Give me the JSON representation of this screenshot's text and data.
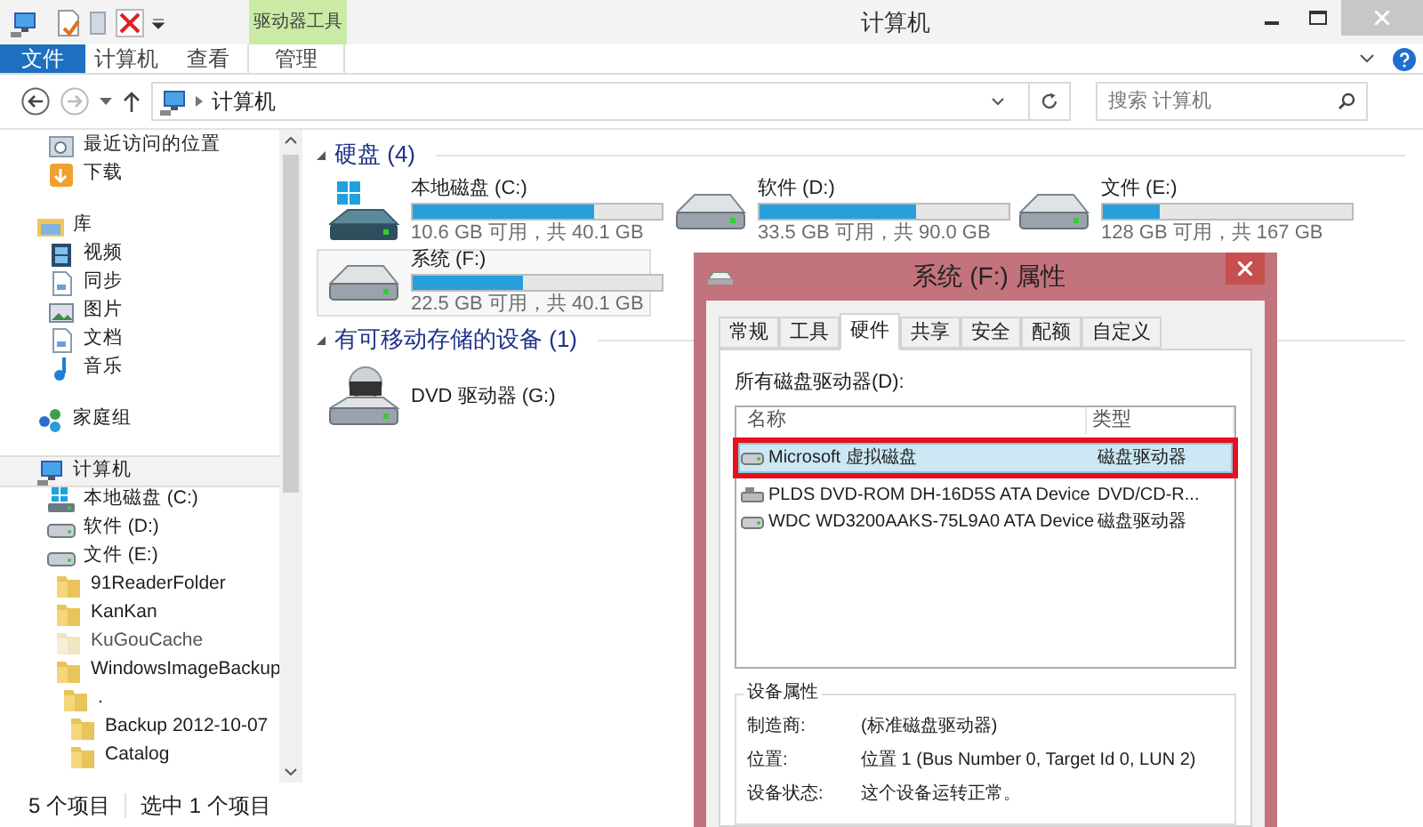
{
  "window": {
    "title": "计算机",
    "contextual_tab": "驱动器工具"
  },
  "ribbon_tabs": [
    {
      "label": "文件",
      "kind": "file",
      "selected": false
    },
    {
      "label": "计算机",
      "kind": "tab",
      "selected": false
    },
    {
      "label": "查看",
      "kind": "tab",
      "selected": false
    },
    {
      "label": "管理",
      "kind": "contextual",
      "selected": false
    }
  ],
  "address_bar": {
    "path": "计算机"
  },
  "search": {
    "placeholder": "搜索 计算机"
  },
  "nav": {
    "sections": [
      {
        "items": [
          {
            "label": "最近访问的位置",
            "kind": "recent",
            "selected": false
          },
          {
            "label": "下载",
            "kind": "download",
            "selected": false
          }
        ]
      },
      {
        "header": {
          "label": "库",
          "kind": "library",
          "selected": false
        },
        "items": [
          {
            "label": "视频",
            "kind": "video",
            "selected": false
          },
          {
            "label": "同步",
            "kind": "doc",
            "selected": false
          },
          {
            "label": "图片",
            "kind": "picture",
            "selected": false
          },
          {
            "label": "文档",
            "kind": "doc",
            "selected": false
          },
          {
            "label": "音乐",
            "kind": "music",
            "selected": false
          }
        ]
      },
      {
        "header": {
          "label": "家庭组",
          "kind": "homegroup",
          "selected": false
        }
      },
      {
        "header": {
          "label": "计算机",
          "kind": "computer",
          "selected": true
        },
        "items": [
          {
            "label": "本地磁盘 (C:)",
            "kind": "system-drive",
            "selected": false
          },
          {
            "label": "软件 (D:)",
            "kind": "drive",
            "selected": false
          },
          {
            "label": "文件 (E:)",
            "kind": "drive",
            "selected": false,
            "children": [
              {
                "label": "91ReaderFolder",
                "kind": "folder",
                "selected": false
              },
              {
                "label": "KanKan",
                "kind": "folder",
                "selected": false
              },
              {
                "label": "KuGouCache",
                "kind": "faded-folder",
                "selected": false
              },
              {
                "label": "WindowsImageBackup",
                "kind": "folder",
                "selected": false,
                "children": [
                  {
                    "label": ".",
                    "kind": "folder",
                    "selected": false,
                    "children": [
                      {
                        "label": "Backup 2012-10-07",
                        "kind": "folder",
                        "selected": false
                      },
                      {
                        "label": "Catalog",
                        "kind": "folder",
                        "selected": false
                      }
                    ]
                  }
                ]
              }
            ]
          }
        ]
      }
    ]
  },
  "groups": [
    {
      "title": "硬盘 (4)",
      "items": [
        {
          "name": "本地磁盘 (C:)",
          "kind": "system-drive",
          "level": 0.73,
          "space": "10.6 GB 可用，共 40.1 GB",
          "selected": false
        },
        {
          "name": "软件 (D:)",
          "kind": "drive",
          "level": 0.63,
          "space": "33.5 GB 可用，共 90.0 GB",
          "selected": false
        },
        {
          "name": "文件 (E:)",
          "kind": "drive",
          "level": 0.23,
          "space": "128 GB 可用，共 167 GB",
          "selected": false
        },
        {
          "name": "系统 (F:)",
          "kind": "drive",
          "level": 0.44,
          "space": "22.5 GB 可用，共 40.1 GB",
          "selected": true
        }
      ]
    },
    {
      "title": "有可移动存储的设备 (1)",
      "items": [
        {
          "name": "DVD 驱动器 (G:)",
          "kind": "dvd",
          "selected": false
        }
      ]
    }
  ],
  "status_bar": {
    "count": "5 个项目",
    "selection": "选中 1 个项目"
  },
  "dialog": {
    "title": "系统 (F:) 属性",
    "tabs": [
      {
        "label": "常规",
        "selected": false
      },
      {
        "label": "工具",
        "selected": false
      },
      {
        "label": "硬件",
        "selected": true
      },
      {
        "label": "共享",
        "selected": false
      },
      {
        "label": "安全",
        "selected": false
      },
      {
        "label": "配额",
        "selected": false
      },
      {
        "label": "自定义",
        "selected": false
      }
    ],
    "list_label": "所有磁盘驱动器(D):",
    "columns": [
      "名称",
      "类型"
    ],
    "rows": [
      {
        "name": "Microsoft 虚拟磁盘",
        "type": "磁盘驱动器",
        "kind": "disk",
        "selected": true,
        "annotated": true
      },
      {
        "name": "PLDS DVD-ROM DH-16D5S ATA Device",
        "type": "DVD/CD-R...",
        "kind": "optical",
        "selected": false,
        "annotated": false
      },
      {
        "name": "WDC WD3200AAKS-75L9A0 ATA Device",
        "type": "磁盘驱动器",
        "kind": "disk",
        "selected": false,
        "annotated": false
      }
    ],
    "properties_title": "设备属性",
    "properties": [
      {
        "label": "制造商:",
        "value": "(标准磁盘驱动器)"
      },
      {
        "label": "位置:",
        "value": "位置 1 (Bus Number 0, Target Id 0, LUN 2)"
      },
      {
        "label": "设备状态:",
        "value": "这个设备运转正常。"
      }
    ]
  }
}
